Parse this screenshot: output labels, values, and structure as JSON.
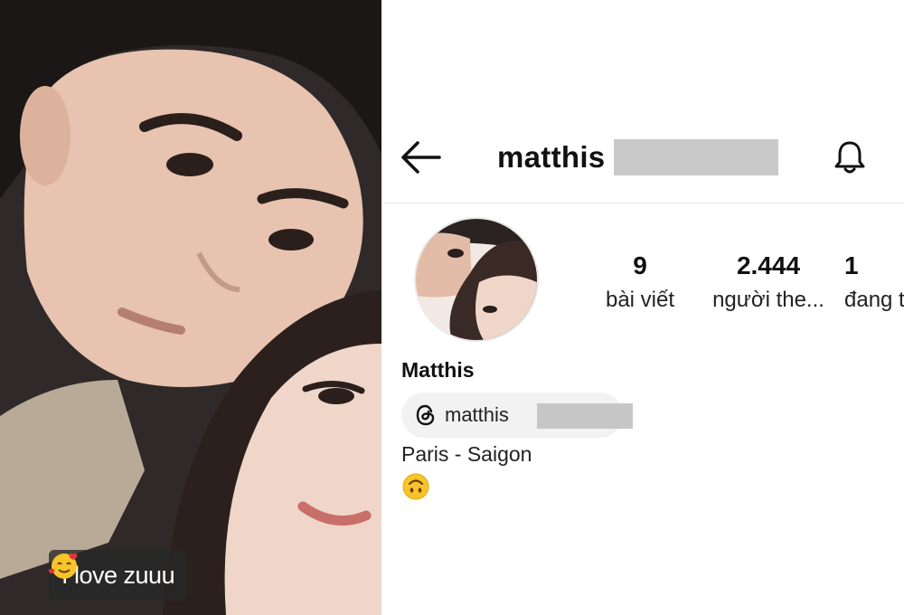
{
  "story": {
    "caption": "I love zuuu",
    "caption_emoji": "smiling-face-with-hearts-icon"
  },
  "profile": {
    "username": "matthis",
    "back_icon": "arrow-left-icon",
    "bell_icon": "bell-icon",
    "stats": {
      "posts_count": "9",
      "posts_label": "bài viết",
      "followers_count": "2.444",
      "followers_label": "người the...",
      "following_count": "1",
      "following_label": "đang t"
    },
    "display_name": "Matthis",
    "threads_handle": "matthis",
    "threads_icon": "threads-icon",
    "bio_location": "Paris - Saigon",
    "bio_emoji": "upside-down-face-icon",
    "colors": {
      "text": "#111111",
      "chip_bg": "#f2f2f2",
      "redaction": "#c9c9c9",
      "emoji_yellow": "#f7c52a"
    }
  }
}
